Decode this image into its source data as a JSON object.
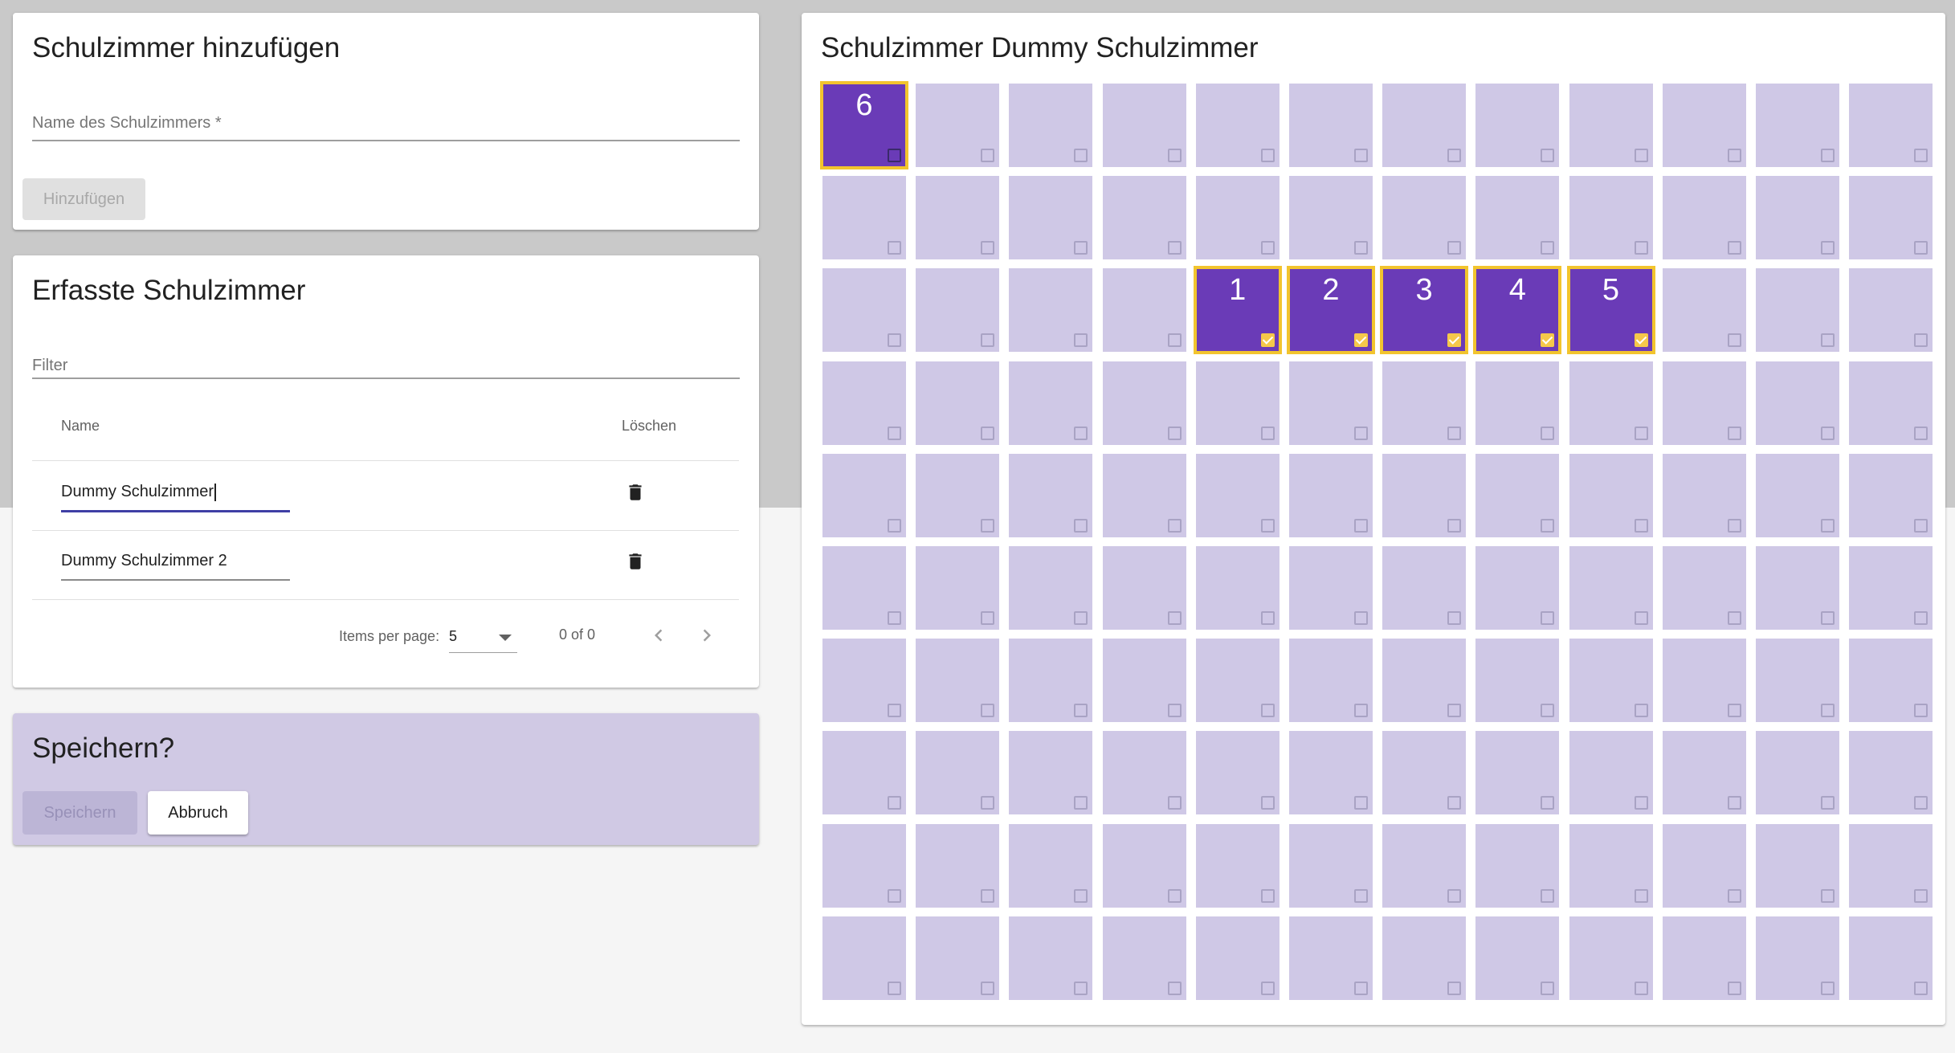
{
  "add_room": {
    "title": "Schulzimmer hinzufügen",
    "name_label": "Name des Schulzimmers *",
    "add_button": "Hinzufügen"
  },
  "room_list": {
    "title": "Erfasste Schulzimmer",
    "filter_label": "Filter",
    "columns": {
      "name": "Name",
      "delete": "Löschen"
    },
    "rows": [
      {
        "name": "Dummy Schulzimmer"
      },
      {
        "name": "Dummy Schulzimmer 2"
      }
    ],
    "paginator": {
      "items_per_page_label": "Items per page:",
      "page_size": "5",
      "range": "0 of 0"
    }
  },
  "save_panel": {
    "title": "Speichern?",
    "save_button": "Speichern",
    "cancel_button": "Abbruch"
  },
  "seat_grid": {
    "title": "Schulzimmer Dummy Schulzimmer",
    "columns": 12,
    "rows": 10,
    "selected": [
      {
        "row": 0,
        "col": 0,
        "label": "6",
        "checked": false
      },
      {
        "row": 2,
        "col": 4,
        "label": "1",
        "checked": true
      },
      {
        "row": 2,
        "col": 5,
        "label": "2",
        "checked": true
      },
      {
        "row": 2,
        "col": 6,
        "label": "3",
        "checked": true
      },
      {
        "row": 2,
        "col": 7,
        "label": "4",
        "checked": true
      },
      {
        "row": 2,
        "col": 8,
        "label": "5",
        "checked": true
      }
    ]
  },
  "colors": {
    "seat_empty": "#cfc8e6",
    "seat_selected": "#6a3bb7",
    "seat_highlight": "#f2c42e",
    "save_panel_bg": "#d0c9e4"
  },
  "icons": {
    "delete": "trash-icon",
    "prev": "chevron-left-icon",
    "next": "chevron-right-icon",
    "dropdown": "caret-down-icon",
    "seat_checkbox": "checkbox-icon"
  }
}
